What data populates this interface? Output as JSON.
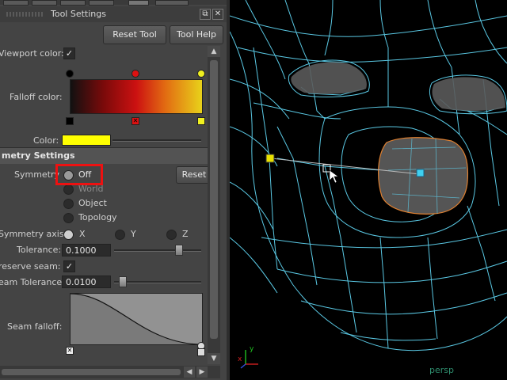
{
  "panel": {
    "title": "Tool Settings",
    "reset_tool": "Reset Tool",
    "tool_help": "Tool Help"
  },
  "color_settings": {
    "viewport_color_label": "Viewport color:",
    "falloff_color_label": "Falloff color:",
    "color_label": "Color:",
    "color_value": "#ffff00",
    "gradient_colors": [
      "#111111",
      "#7a0a0a",
      "#cc1111",
      "#e26b12",
      "#e8d21a"
    ]
  },
  "symmetry": {
    "section_title": "metry Settings",
    "symmetry_label": "Symmetry",
    "options": [
      "Off",
      "World",
      "Object",
      "Topology"
    ],
    "selected": "Off",
    "reset": "Reset",
    "axis_label": "Symmetry axis:",
    "axes": [
      "X",
      "Y",
      "Z"
    ],
    "tolerance_label": "Tolerance:",
    "tolerance_value": "0.1000",
    "preserve_seam_label": "reserve seam:",
    "seam_tolerance_label": "eam Tolerance:",
    "seam_tolerance_value": "0.0100",
    "seam_falloff_label": "Seam falloff:"
  },
  "viewport": {
    "camera_label": "persp",
    "axis_x": "x",
    "axis_y": "y",
    "wire_color": "#5fd3f0",
    "highlight_color": "#e08030"
  }
}
